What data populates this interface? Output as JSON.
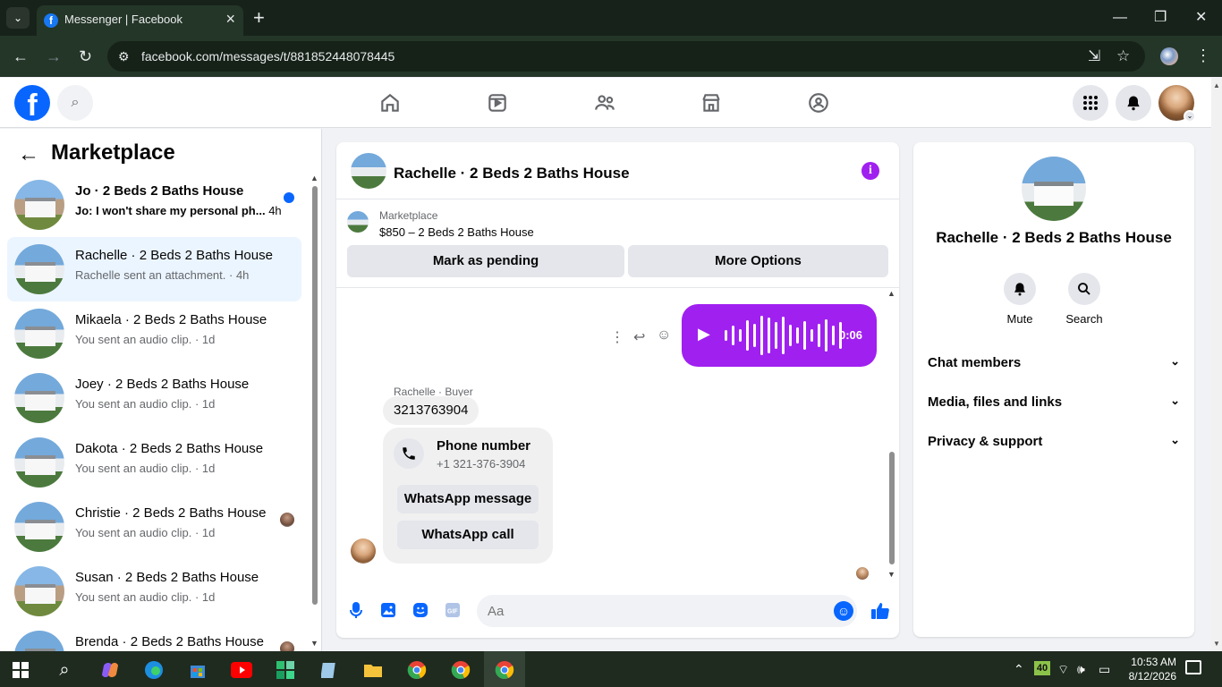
{
  "browser": {
    "tab_title": "Messenger | Facebook",
    "url": "facebook.com/messages/t/881852448078445"
  },
  "sidebar": {
    "title": "Marketplace",
    "conversations": [
      {
        "title": "Jo · 2 Beds 2 Baths House",
        "preview": "Jo: I won't share my personal ph...",
        "time": "4h",
        "unread": true,
        "thumb": "brown"
      },
      {
        "title": "Rachelle · 2 Beds 2 Baths House",
        "preview": "Rachelle sent an attachment.",
        "time": "4h",
        "active": true
      },
      {
        "title": "Mikaela · 2 Beds 2 Baths House",
        "preview": "You sent an audio clip.",
        "time": "1d"
      },
      {
        "title": "Joey · 2 Beds 2 Baths House",
        "preview": "You sent an audio clip.",
        "time": "1d"
      },
      {
        "title": "Dakota · 2 Beds 2 Baths House",
        "preview": "You sent an audio clip.",
        "time": "1d"
      },
      {
        "title": "Christie · 2 Beds 2 Baths House",
        "preview": "You sent an audio clip.",
        "time": "1d",
        "seen": true
      },
      {
        "title": "Susan · 2 Beds 2 Baths House",
        "preview": "You sent an audio clip.",
        "time": "1d",
        "thumb": "brown"
      },
      {
        "title": "Brenda · 2 Beds 2 Baths House",
        "preview": "",
        "time": "",
        "seen": true
      }
    ]
  },
  "chat": {
    "title": "Rachelle · 2 Beds 2 Baths House",
    "marketplace_label": "Marketplace",
    "listing": "$850 – 2 Beds 2 Baths House",
    "mark_pending": "Mark as pending",
    "more_options": "More Options",
    "audio_duration": "0:06",
    "sender_label": "Rachelle · Buyer",
    "phone_message": "3213763904",
    "card_title": "Phone number",
    "card_subtitle": "+1 321-376-3904",
    "whatsapp_message": "WhatsApp message",
    "whatsapp_call": "WhatsApp call",
    "composer_placeholder": "Aa"
  },
  "info_panel": {
    "title": "Rachelle · 2 Beds 2 Baths House",
    "mute_label": "Mute",
    "search_label": "Search",
    "sections": [
      "Chat members",
      "Media, files and links",
      "Privacy & support"
    ]
  },
  "taskbar": {
    "battery_badge": "40",
    "time": "10:53 AM",
    "date": "8/12/2026"
  },
  "colors": {
    "facebook_blue": "#0866ff",
    "messenger_purple": "#a020f0",
    "active_row": "#ebf5ff"
  }
}
